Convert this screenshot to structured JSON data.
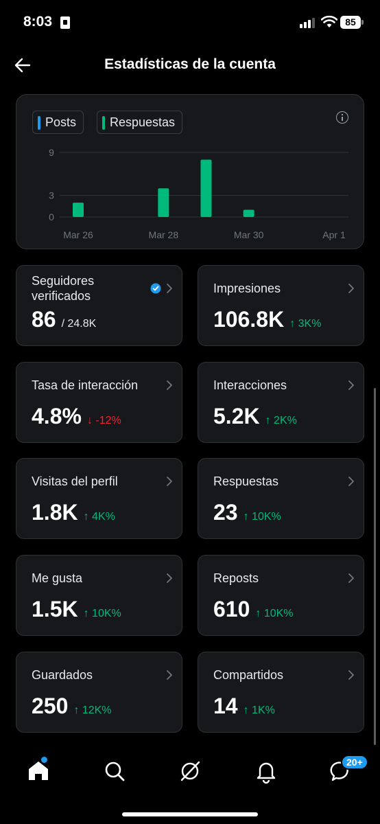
{
  "status_bar": {
    "time": "8:03",
    "battery": "85"
  },
  "header": {
    "title": "Estadísticas de la cuenta"
  },
  "legend": [
    {
      "label": "Posts",
      "color": "#1d9bf0"
    },
    {
      "label": "Respuestas",
      "color": "#00ba7c"
    }
  ],
  "chart_data": {
    "type": "bar",
    "x": [
      "Mar 26",
      "Mar 27",
      "Mar 28",
      "Mar 29",
      "Mar 30",
      "Mar 31",
      "Apr 1"
    ],
    "x_tick_labels": [
      "Mar 26",
      "Mar 28",
      "Mar 30",
      "Apr 1"
    ],
    "series": [
      {
        "name": "Posts",
        "values": [
          0,
          0,
          0,
          0,
          0,
          0,
          0
        ],
        "color": "#1d9bf0"
      },
      {
        "name": "Respuestas",
        "values": [
          2,
          0,
          4,
          8,
          1,
          0,
          0
        ],
        "color": "#00ba7c"
      }
    ],
    "y_ticks": [
      0,
      3,
      9
    ],
    "ylim": [
      0,
      9
    ],
    "grid": true
  },
  "stats": [
    {
      "label": "Seguidores verificados",
      "value": "86",
      "total": "/ 24.8K",
      "verified": true
    },
    {
      "label": "Impresiones",
      "value": "106.8K",
      "change": "↑ 3K%",
      "direction": "up"
    },
    {
      "label": "Tasa de interacción",
      "value": "4.8%",
      "change": "↓ -12%",
      "direction": "down"
    },
    {
      "label": "Interacciones",
      "value": "5.2K",
      "change": "↑ 2K%",
      "direction": "up"
    },
    {
      "label": "Visitas del perfil",
      "value": "1.8K",
      "change": "↑ 4K%",
      "direction": "up"
    },
    {
      "label": "Respuestas",
      "value": "23",
      "change": "↑ 10K%",
      "direction": "up"
    },
    {
      "label": "Me gusta",
      "value": "1.5K",
      "change": "↑ 10K%",
      "direction": "up"
    },
    {
      "label": "Reposts",
      "value": "610",
      "change": "↑ 10K%",
      "direction": "up"
    },
    {
      "label": "Guardados",
      "value": "250",
      "change": "↑ 12K%",
      "direction": "up"
    },
    {
      "label": "Compartidos",
      "value": "14",
      "change": "↑ 1K%",
      "direction": "up"
    }
  ],
  "nav": {
    "items": [
      "home-icon",
      "search-icon",
      "grok-icon",
      "bell-icon",
      "messages-icon"
    ],
    "messages_badge": "20+"
  }
}
